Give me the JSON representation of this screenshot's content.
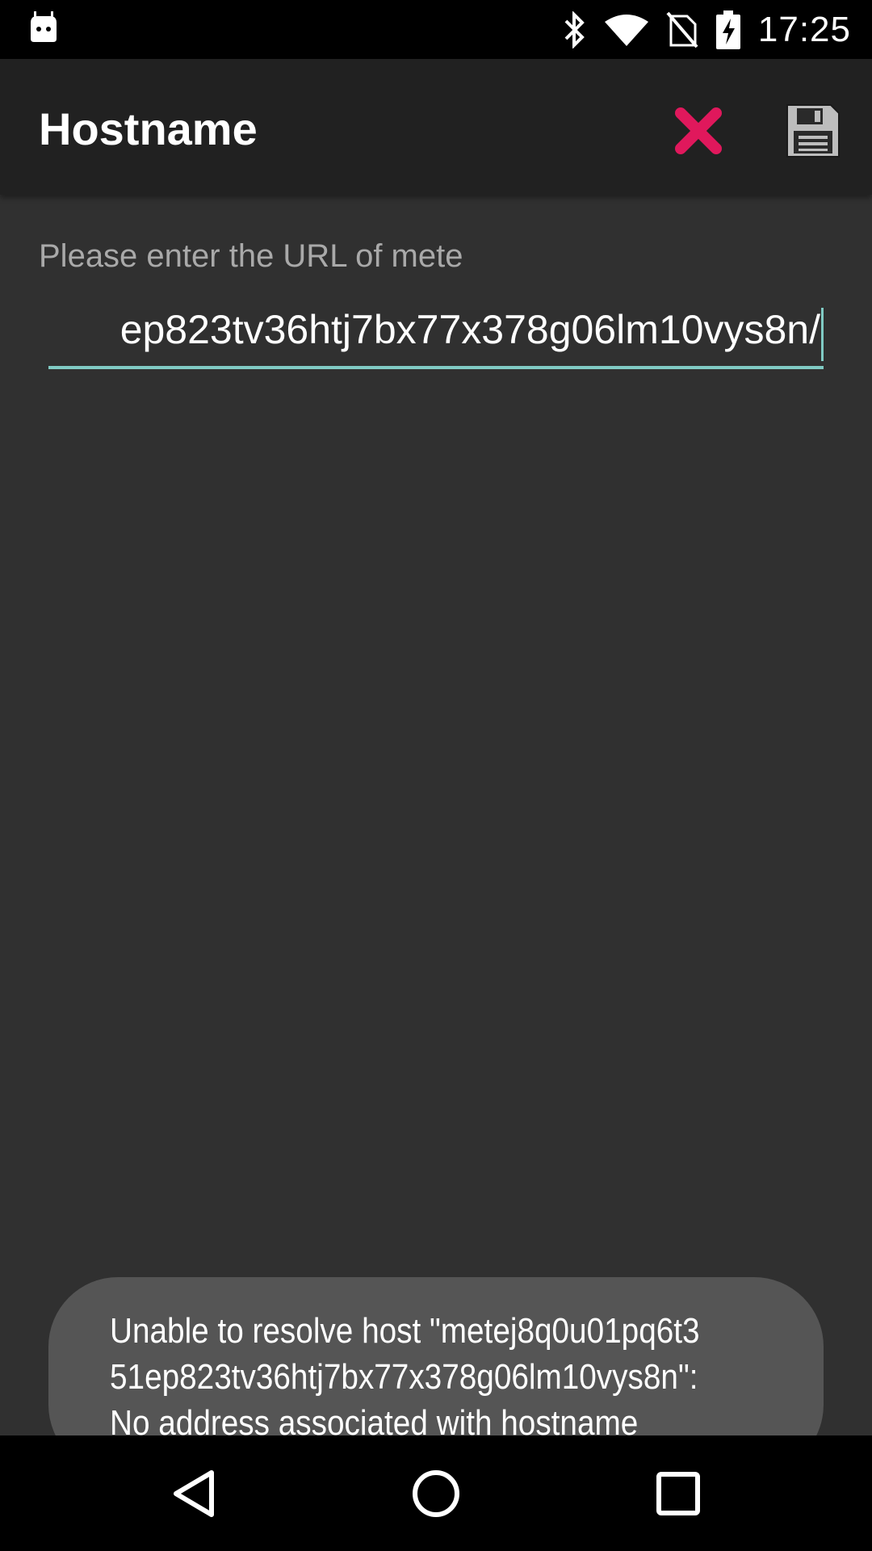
{
  "status_bar": {
    "time": "17:25",
    "icons": [
      "android-debug-icon",
      "bluetooth-icon",
      "wifi-icon",
      "no-sim-icon",
      "battery-charging-icon"
    ]
  },
  "app_bar": {
    "title": "Hostname",
    "actions": [
      {
        "name": "cancel",
        "icon": "close-icon",
        "color": "#e0185c"
      },
      {
        "name": "save",
        "icon": "floppy-disk-icon",
        "color": "#bdbdbd"
      }
    ]
  },
  "form": {
    "label": "Please enter the URL of mete",
    "url_value": "ep823tv36htj7bx77x378g06lm10vys8n/",
    "accent_color": "#80cbc4"
  },
  "toast": {
    "lines": [
      "Unable to resolve host \"metej8q0u01pq6t3",
      "51ep823tv36htj7bx77x378g06lm10vys8n\":",
      "No address associated with hostname"
    ]
  },
  "nav_bar": {
    "buttons": [
      "back-icon",
      "home-icon",
      "recents-icon"
    ]
  }
}
